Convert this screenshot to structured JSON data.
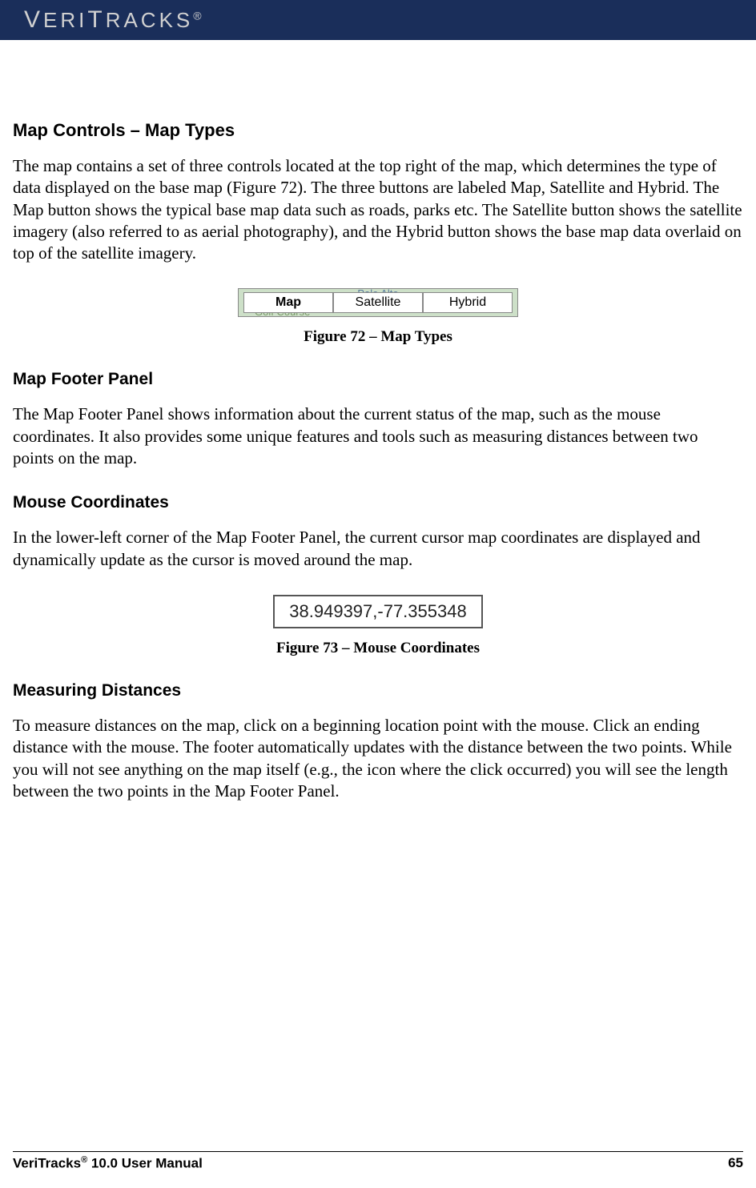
{
  "header": {
    "logo_main": "ERI",
    "logo_tail": "RACKS",
    "logo_reg": "®"
  },
  "sections": {
    "map_controls": {
      "heading": " Map Controls – Map Types",
      "body": "The map contains a set of three controls located at the top right of the map, which determines the type of data displayed on the base map (Figure 72). The three buttons are labeled Map, Satellite and Hybrid. The Map button shows the typical base map data such as roads, parks etc. The Satellite button shows the satellite imagery (also referred to as aerial photography), and the Hybrid button shows the base map data overlaid on top of the satellite imagery."
    },
    "figure72": {
      "bg_top": "Palo Alto",
      "bg_bot": "Golf Course",
      "buttons": [
        "Map",
        "Satellite",
        "Hybrid"
      ],
      "caption": "Figure 72 – Map Types"
    },
    "map_footer": {
      "heading": "Map Footer Panel",
      "body": "The Map Footer Panel shows information about the current status of the map, such as the mouse coordinates. It also provides some unique features and tools such as measuring distances between two points on the map."
    },
    "mouse_coords": {
      "heading": "Mouse Coordinates",
      "body": "In the lower-left corner of the Map Footer Panel, the current cursor map coordinates are displayed and dynamically update as the cursor is moved around the map."
    },
    "figure73": {
      "value": "38.949397,-77.355348",
      "caption": "Figure 73 – Mouse Coordinates"
    },
    "measuring": {
      "heading": "Measuring Distances",
      "body": "To measure distances on the map, click on a beginning location point with the mouse.  Click an ending distance with the mouse.  The footer automatically updates with the distance between the two points. While you will not see anything on the map itself (e.g., the icon where the click occurred) you will see the length between the two points in the Map Footer Panel."
    }
  },
  "footer": {
    "left_pre": "VeriTracks",
    "left_sup": "®",
    "left_post": " 10.0 User Manual",
    "page": "65"
  }
}
